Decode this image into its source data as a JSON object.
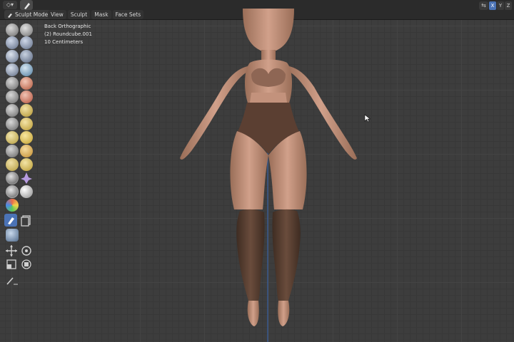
{
  "header": {
    "editor_icon": "editor-type-icon",
    "mode_label": "Sculpt Mode",
    "menus": [
      "View",
      "Sculpt",
      "Mask",
      "Face Sets"
    ],
    "axis_buttons": [
      "X",
      "Y",
      "Z"
    ],
    "accent": "#4b73b6"
  },
  "viewport": {
    "view_name": "Back Orthographic",
    "object_name": "(2) Roundcube.001",
    "grid_scale": "10 Centimeters"
  },
  "toolbar": {
    "icons": [
      "draw-brush-icon",
      "draw-sharp-brush-icon",
      "clay-brush-icon",
      "clay-strips-brush-icon",
      "clay-thumb-brush-icon",
      "layer-brush-icon",
      "inflate-brush-icon",
      "blob-brush-icon",
      "crease-brush-icon",
      "smooth-brush-icon",
      "flatten-brush-icon",
      "fill-brush-icon",
      "scrape-brush-icon",
      "multiplane-scrape-brush-icon",
      "pinch-brush-icon",
      "grab-brush-icon",
      "elastic-deform-brush-icon",
      "snake-hook-brush-icon",
      "thumb-brush-icon",
      "pose-brush-icon",
      "nudge-brush-icon",
      "rotate-brush-icon",
      "slide-relax-brush-icon",
      "boundary-brush-icon",
      "cloth-brush-icon",
      "simplify-brush-icon",
      "mask-brush-icon",
      "box-mask-icon",
      "face-set-icon",
      "move-icon",
      "rotate-icon",
      "scale-icon",
      "transform-icon",
      "annotate-icon"
    ]
  }
}
